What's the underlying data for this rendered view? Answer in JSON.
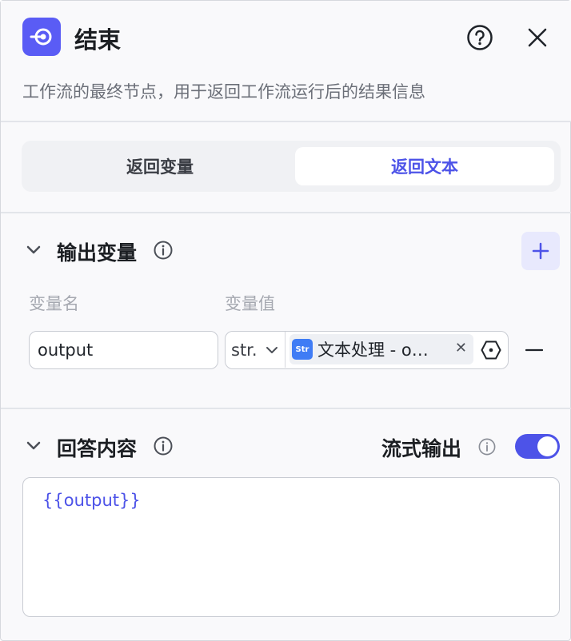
{
  "header": {
    "title": "结束",
    "description": "工作流的最终节点，用于返回工作流运行后的结果信息",
    "icons": [
      "end-node-icon",
      "help-icon",
      "close-icon"
    ]
  },
  "segmented": {
    "options": [
      "返回变量",
      "返回文本"
    ],
    "selected": "返回文本"
  },
  "output_section": {
    "title": "输出变量",
    "col_name": "变量名",
    "col_value": "变量值",
    "rows": [
      {
        "name": "output",
        "type": "str.",
        "reference": "文本处理 - o…"
      }
    ]
  },
  "answer_section": {
    "title": "回答内容",
    "stream_label": "流式输出",
    "stream_enabled": true,
    "content": "{{output}}"
  },
  "colors": {
    "accent": "#4d53e8",
    "node_icon_bg": "#5a5cf5",
    "str_icon_bg": "#3f7cf5"
  }
}
